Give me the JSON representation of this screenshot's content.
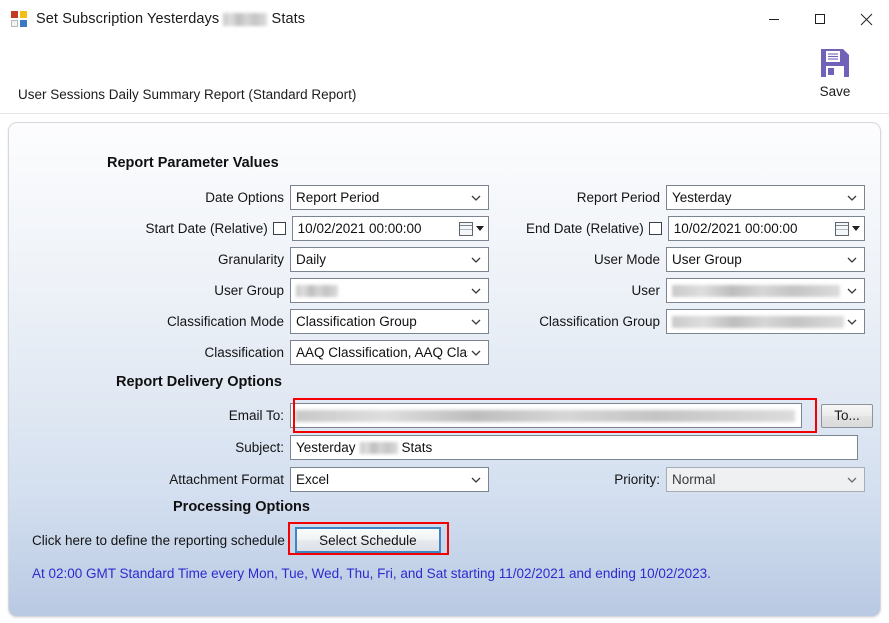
{
  "window": {
    "title_prefix": "Set Subscription Yesterdays",
    "title_redacted": "[redacted]",
    "title_suffix": "Stats",
    "app_icon": "app-squares-icon",
    "controls": {
      "minimize": "minimize-icon",
      "maximize": "maximize-icon",
      "close": "close-icon"
    }
  },
  "header": {
    "report_name": "User Sessions Daily Summary Report (Standard Report)",
    "save_label": "Save",
    "save_icon": "floppy-disk-save-icon",
    "save_icon_color": "#7161b8"
  },
  "sections": {
    "parameters_title": "Report Parameter Values",
    "delivery_title": "Report Delivery Options",
    "processing_title": "Processing Options"
  },
  "parameters": {
    "date_options": {
      "label": "Date Options",
      "value": "Report Period"
    },
    "report_period": {
      "label": "Report Period",
      "value": "Yesterday"
    },
    "start_date": {
      "label": "Start Date",
      "relative_label": "(Relative)",
      "relative_checked": false,
      "value": "10/02/2021 00:00:00"
    },
    "end_date": {
      "label": "End Date",
      "relative_label": "(Relative)",
      "relative_checked": false,
      "value": "10/02/2021 00:00:00"
    },
    "granularity": {
      "label": "Granularity",
      "value": "Daily"
    },
    "user_mode": {
      "label": "User Mode",
      "value": "User Group"
    },
    "user_group": {
      "label": "User Group",
      "value": "[redacted]"
    },
    "user": {
      "label": "User",
      "value": "[redacted]"
    },
    "classification_mode": {
      "label": "Classification Mode",
      "value": "Classification Group"
    },
    "classification_group": {
      "label": "Classification Group",
      "value": "[redacted]"
    },
    "classification": {
      "label": "Classification",
      "value": "AAQ Classification, AAQ Clas"
    }
  },
  "delivery": {
    "email_to": {
      "label": "Email To:",
      "value": "[redacted]",
      "highlighted": true
    },
    "to_button": {
      "label": "To..."
    },
    "subject": {
      "label": "Subject:",
      "value_prefix": "Yesterday",
      "value_redacted": "[redacted]",
      "value_suffix": "Stats"
    },
    "attachment_format": {
      "label": "Attachment Format",
      "value": "Excel"
    },
    "priority": {
      "label": "Priority:",
      "value": "Normal",
      "disabled": true
    }
  },
  "processing": {
    "hint": "Click here to define the reporting schedule",
    "select_schedule_button": "Select Schedule",
    "schedule_summary": "At 02:00 GMT Standard Time every Mon, Tue, Wed, Thu, Fri, and Sat starting 11/02/2021 and ending 10/02/2023."
  },
  "colors": {
    "highlight_red": "#f50000",
    "focus_blue": "#3d86c6",
    "schedule_text": "#2b2bd0",
    "save_purple": "#7161b8"
  }
}
